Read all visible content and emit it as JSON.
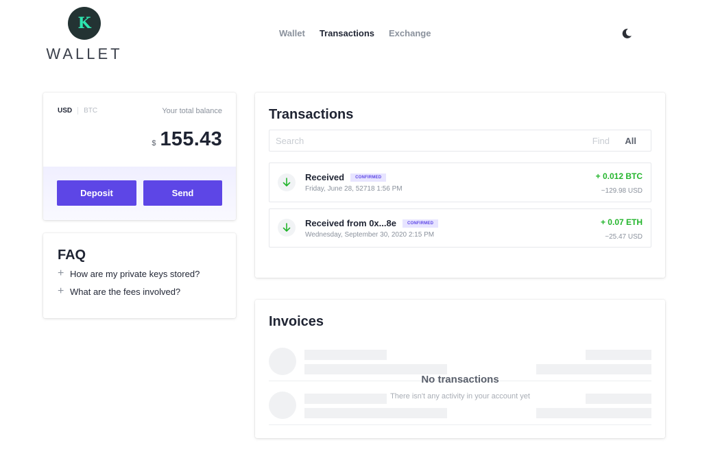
{
  "brand": {
    "logo_letter": "K",
    "wordmark": "WALLET",
    "logo_bg": "#233333",
    "logo_fg": "#2ee6b0"
  },
  "nav": {
    "items": [
      "Wallet",
      "Transactions",
      "Exchange"
    ],
    "active": "Transactions"
  },
  "theme_toggle": {
    "icon": "moon-icon"
  },
  "balance": {
    "currency_usd": "USD",
    "currency_btc": "BTC",
    "selected_currency": "USD",
    "total_label": "Your total balance",
    "currency_symbol": "$",
    "amount": "155.43",
    "deposit_label": "Deposit",
    "send_label": "Send"
  },
  "faq": {
    "title": "FAQ",
    "items": [
      "How are my private keys stored?",
      "What are the fees involved?"
    ]
  },
  "transactions": {
    "title": "Transactions",
    "search_placeholder": "Search",
    "find_label": "Find",
    "all_label": "All",
    "items": [
      {
        "title": "Received",
        "badge": "CONFIRMED",
        "date": "Friday, June 28, 52718 1:56 PM",
        "crypto": "+ 0.012 BTC",
        "fiat": "~129.98 USD"
      },
      {
        "title": "Received from 0x...8e",
        "badge": "CONFIRMED",
        "date": "Wednesday, September 30, 2020 2:15 PM",
        "crypto": "+ 0.07 ETH",
        "fiat": "~25.47 USD"
      }
    ]
  },
  "invoices": {
    "title": "Invoices",
    "empty_title": "No transactions",
    "empty_subtitle": "There isn't any activity in your account yet"
  },
  "colors": {
    "accent": "#5d46e6",
    "positive": "#23b52c",
    "badge_bg": "#e7e4ff"
  }
}
